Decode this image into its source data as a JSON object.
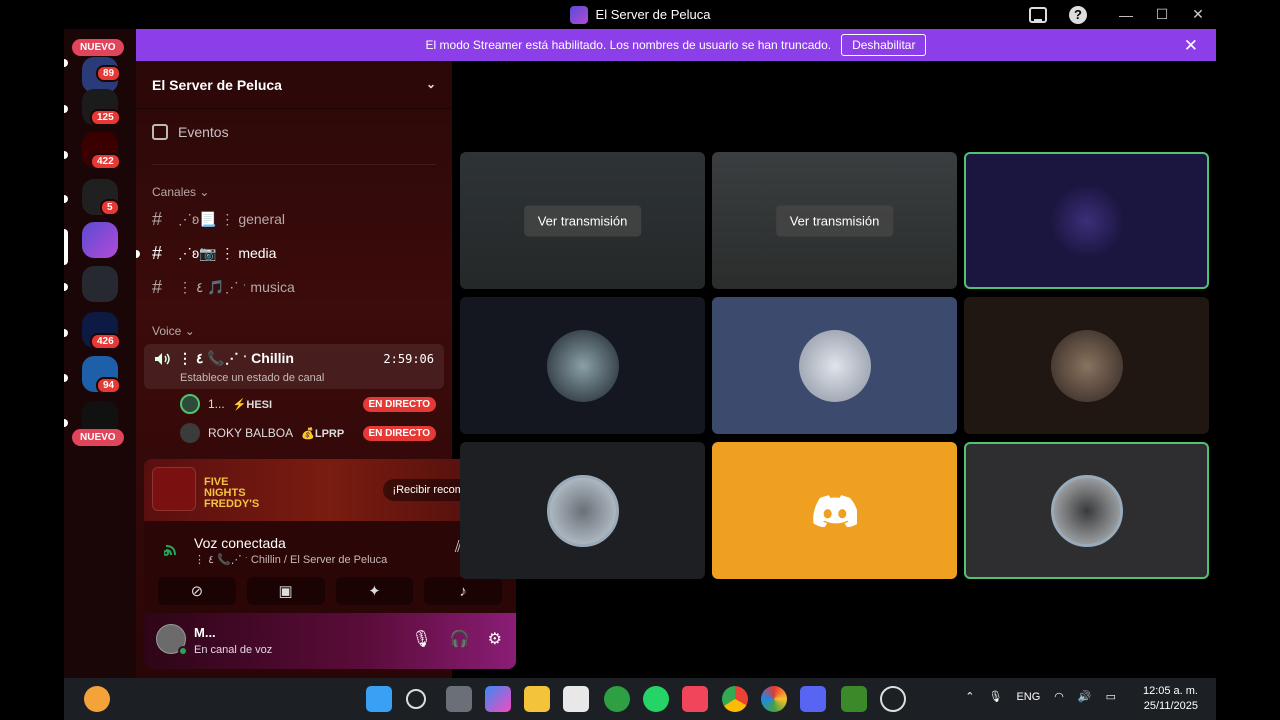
{
  "window": {
    "title": "El Server de Peluca"
  },
  "banner": {
    "text": "El modo Streamer está habilitado. Los nombres de usuario se han truncado.",
    "button": "Deshabilitar"
  },
  "rail": {
    "new_badge_top": "NUEVO",
    "new_badge_bottom": "NUEVO",
    "badges": [
      "89",
      "125",
      "422",
      "5",
      "426",
      "94"
    ]
  },
  "server": {
    "name": "El Server de Peluca",
    "events_label": "Eventos",
    "categories": {
      "text": "Canales",
      "voice": "Voice"
    },
    "channels": [
      {
        "name": "⋰ʚ📃 ⋮ general"
      },
      {
        "name": "⋰ʚ📷 ⋮ media"
      },
      {
        "name": "⋮ ٤ 🎵⋰ ˑ musica"
      }
    ],
    "voice_channel": {
      "name": "⋮ ٤ 📞⋰ ˑ Chillin",
      "timer": "2:59:06",
      "status": "Establece un estado de canal"
    },
    "voice_users": [
      {
        "name": "1...",
        "tag": "⚡HESI",
        "live": "EN DIRECTO"
      },
      {
        "name": "ROKY BALBOA",
        "tag": "💰LPRP",
        "live": "EN DIRECTO"
      }
    ]
  },
  "promo": {
    "game": "FIVE NIGHTS FREDDY'S",
    "claim": "¡Recibir recompensa!"
  },
  "voice_panel": {
    "title": "Voz conectada",
    "subtitle": "⋮ ٤ 📞⋰ ˑ Chillin / El Server de Peluca"
  },
  "user": {
    "name": "M...",
    "state": "En canal de voz"
  },
  "tiles": {
    "watch_label": "Ver transmisión"
  },
  "taskbar": {
    "lang": "ENG",
    "time": "12:05 a. m.",
    "date": "25/11/2025"
  },
  "colors": {
    "banner": "#8c3ee8",
    "live": "#e53935",
    "speaking": "#4fc36e",
    "discord_tile": "#f0a020"
  }
}
